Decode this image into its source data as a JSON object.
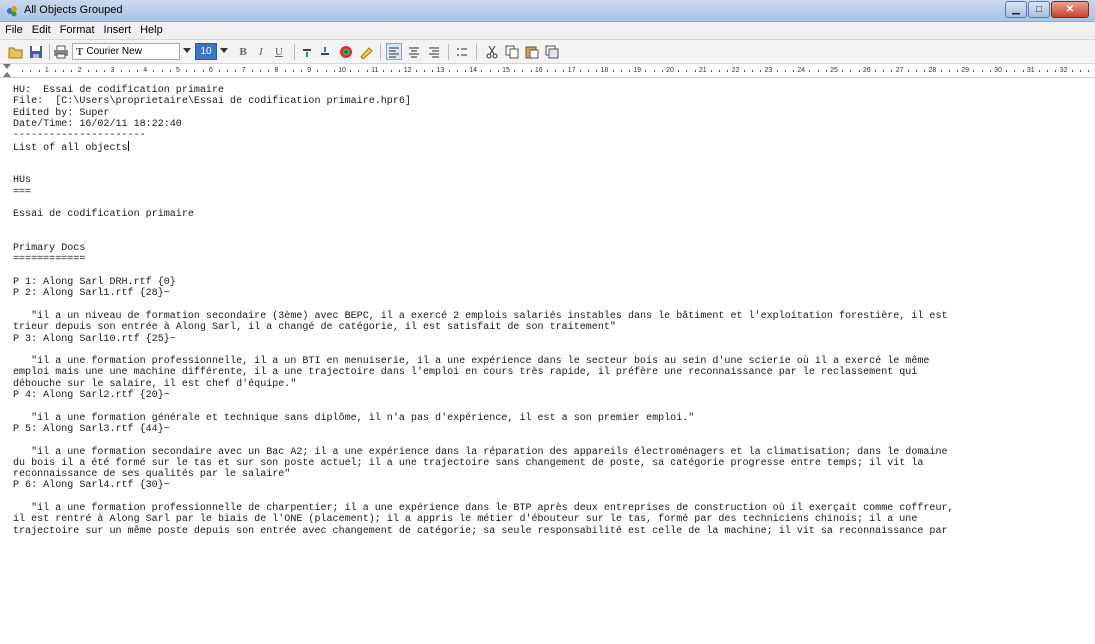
{
  "window": {
    "title": "All Objects Grouped",
    "icon": "app-icon"
  },
  "menubar": {
    "items": [
      "File",
      "Edit",
      "Format",
      "Insert",
      "Help"
    ]
  },
  "toolbar": {
    "font_name": "Courier New",
    "font_size": "10",
    "bold_label": "B",
    "italic_label": "I",
    "underline_label": "U",
    "buttons": [
      "open-icon",
      "save-icon",
      "print-icon",
      "font-icon",
      "bold-icon",
      "italic-icon",
      "underline-icon",
      "decrease-indent-icon",
      "increase-indent-icon",
      "color-icon",
      "highlight-icon",
      "align-left-icon",
      "align-center-icon",
      "align-right-icon",
      "bullets-icon",
      "cut-icon",
      "copy-icon",
      "paste-icon",
      "select-all-icon"
    ]
  },
  "ruler": {
    "marks": [
      "1",
      "2",
      "3",
      "4",
      "5",
      "6",
      "7",
      "8",
      "9",
      "10",
      "11",
      "12",
      "13",
      "14",
      "15",
      "16",
      "17",
      "18",
      "19",
      "20",
      "21",
      "22",
      "23",
      "24",
      "25",
      "26",
      "27",
      "28",
      "29",
      "30",
      "31",
      "32",
      "3"
    ]
  },
  "document": {
    "lines": [
      "HU:  Essai de codification primaire",
      "File:  [C:\\Users\\proprietaire\\Essai de codification primaire.hpr6]",
      "Edited by: Super",
      "Date/Time: 16/02/11 18:22:40",
      "----------------------",
      "List of all objects",
      "",
      "",
      "HUs",
      "===",
      "",
      "Essai de codification primaire",
      "",
      "",
      "Primary Docs",
      "============",
      "",
      "P 1: Along Sarl DRH.rtf {0}",
      "P 2: Along Sarl1.rtf {28}~",
      "",
      "   \"il a un niveau de formation secondaire (3ème) avec BEPC, il a exercé 2 emplois salariés instables dans le bâtiment et l'exploitation forestière, il est",
      "trieur depuis son entrée à Along Sarl, il a changé de catégorie, il est satisfait de son traitement\"",
      "P 3: Along Sarl10.rtf {25}~",
      "",
      "   \"il a une formation professionnelle, il a un BTI en menuiserie, il a une expérience dans le secteur bois au sein d'une scierie où il a exercé le même",
      "emploi mais une une machine différente, il a une trajectoire dans l'emploi en cours très rapide, il préfère une reconnaissance par le reclassement qui",
      "débouche sur le salaire, il est chef d'équipe.\"",
      "P 4: Along Sarl2.rtf {20}~",
      "",
      "   \"il a une formation générale et technique sans diplôme, il n'a pas d'expérience, il est a son premier emploi.\"",
      "P 5: Along Sarl3.rtf {44}~",
      "",
      "   \"il a une formation secondaire avec un Bac A2; il a une expérience dans la réparation des appareils électroménagers et la climatisation; dans le domaine",
      "du bois il a été formé sur le tas et sur son poste actuel; il a une trajectoire sans changement de poste, sa catégorie progresse entre temps; il vit la",
      "reconnaissance de ses qualités par le salaire\"",
      "P 6: Along Sarl4.rtf {30}~",
      "",
      "   \"il a une formation professionnelle de charpentier; il a une expérience dans le BTP après deux entreprises de construction où il exerçait comme coffreur,",
      "il est rentré à Along Sarl par le biais de l'ONE (placement); il a appris le métier d'ébouteur sur le tas, formé par des techniciens chinois; il a une",
      "trajectoire sur un même poste depuis son entrée avec changement de catégorie; sa seule responsabilité est celle de la machine; il vit sa reconnaissance par"
    ]
  }
}
